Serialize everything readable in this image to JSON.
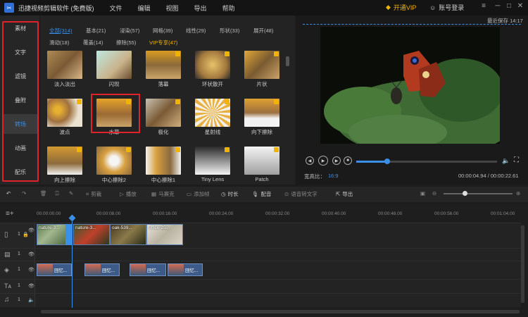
{
  "titlebar": {
    "logo": "app-logo-icon",
    "title": "迅捷视频剪辑软件 (免费版)",
    "menu": [
      "文件",
      "编辑",
      "视图",
      "导出",
      "帮助"
    ],
    "vip_label": "开通VIP",
    "login_label": "账号登录"
  },
  "leftnav": {
    "items": [
      "素材",
      "文字",
      "滤镜",
      "叠附",
      "转场",
      "动画",
      "配乐"
    ],
    "active_index": 4
  },
  "library": {
    "categories_row1": [
      "全部(314)",
      "基本(21)",
      "浸染(57)",
      "网格(39)",
      "线性(29)",
      "形状(33)",
      "展开(48)"
    ],
    "categories_row2": [
      "滑动(18)",
      "覆盖(14)",
      "擦除(55)",
      "VIP专享(47)"
    ],
    "items": [
      {
        "label": "淡入淡出"
      },
      {
        "label": "闪现"
      },
      {
        "label": "落幕"
      },
      {
        "label": "环状散开"
      },
      {
        "label": "片状"
      },
      {
        "label": "波点"
      },
      {
        "label": "水幕"
      },
      {
        "label": "极化"
      },
      {
        "label": "星射线"
      },
      {
        "label": "向下擦除"
      },
      {
        "label": "向上擦除"
      },
      {
        "label": "中心擦除2"
      },
      {
        "label": "中心擦除1"
      },
      {
        "label": "Tiny Lens"
      },
      {
        "label": "Patch"
      }
    ],
    "selected_index": 6
  },
  "preview": {
    "save_status": "最近保存 14:17",
    "aspect_label": "宽高比：",
    "aspect_value": "16:9",
    "time": "00:00:04.94 / 00:00:22.61",
    "progress": 0.22
  },
  "toolbar": {
    "items": [
      "剪裁",
      "播放",
      "马赛克",
      "添加帧",
      "时长",
      "配音",
      "语音转文字",
      "导出"
    ]
  },
  "timeline": {
    "ruler": [
      "00:00:00.00",
      "00:00:08.00",
      "00:00:16.00",
      "00:00:24.00",
      "00:00:32.00",
      "00:00:40.00",
      "00:00:48.00",
      "00:00:56.00",
      "00:01:04.00"
    ],
    "video_clips": [
      "nature-3...",
      "nature-3...",
      "oak-539...",
      "office-25..."
    ],
    "fx_clips": [
      "回忆...",
      "回忆...",
      "回忆...",
      "回忆..."
    ],
    "track_number": "1"
  }
}
